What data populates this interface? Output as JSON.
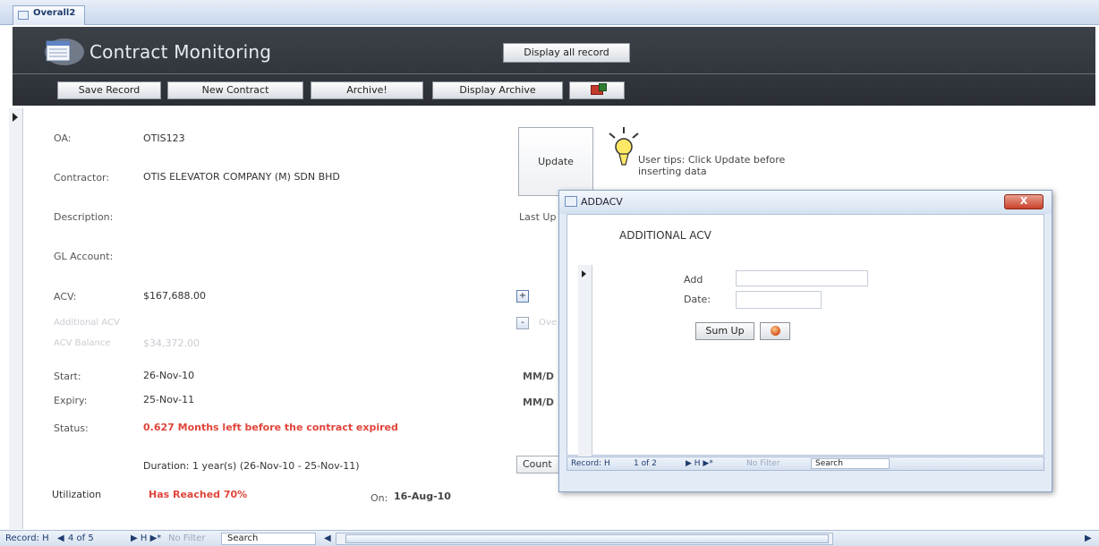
{
  "tab": {
    "label": "Overall2"
  },
  "header": {
    "title": "Contract Monitoring",
    "display_all_label": "Display all record",
    "toolbar": {
      "save_label": "Save Record",
      "new_label": "New Contract",
      "archive_label": "Archive!",
      "display_archive_label": "Display Archive",
      "excel_icon": "excel-export-icon"
    }
  },
  "form": {
    "oa": {
      "label": "OA:",
      "value": "OTIS123"
    },
    "contractor": {
      "label": "Contractor:",
      "value": "OTIS ELEVATOR COMPANY (M) SDN BHD"
    },
    "description": {
      "label": "Description:"
    },
    "gl_account": {
      "label": "GL Account:"
    },
    "acv": {
      "label": "ACV:",
      "value": "$167,688.00"
    },
    "additional_acv": {
      "label": "Additional ACV"
    },
    "acv_balance": {
      "label": "ACV Balance",
      "value": "$34,372.00"
    },
    "start": {
      "label": "Start:",
      "value": "26-Nov-10"
    },
    "expiry": {
      "label": "Expiry:",
      "value": "25-Nov-11"
    },
    "status": {
      "label": "Status:",
      "value": "0.627 Months left before the contract expired"
    },
    "duration": "Duration: 1 year(s) (26-Nov-10 - 25-Nov-11)",
    "utilization": {
      "label": "Utilization",
      "value": "Has Reached 70%",
      "on_label": "On:",
      "on_value": "16-Aug-10"
    }
  },
  "side": {
    "update_label": "Update",
    "tips": "User tips: Click Update before inserting data",
    "last_update": "Last Up",
    "plus": "+",
    "minus": "-",
    "minus_faded": "Ove",
    "mmd1": "MM/D",
    "mmd2": "MM/D",
    "count_label": "Count"
  },
  "popup": {
    "title": "ADDACV",
    "close": "X",
    "heading": "ADDITIONAL ACV",
    "add_label": "Add",
    "date_label": "Date:",
    "sumup_label": "Sum Up",
    "nav": {
      "record": "Record: H",
      "pos": "1 of 2",
      "arrows": "▶ H ▶*",
      "filter": "No Filter",
      "search": "Search"
    }
  },
  "navbar": {
    "record": "Record: H",
    "prev": "◀",
    "pos": "4 of 5",
    "arrows": "▶ H ▶*",
    "filter": "No Filter",
    "search": "Search",
    "scroll_left": "◀",
    "scroll_right": "▶"
  }
}
